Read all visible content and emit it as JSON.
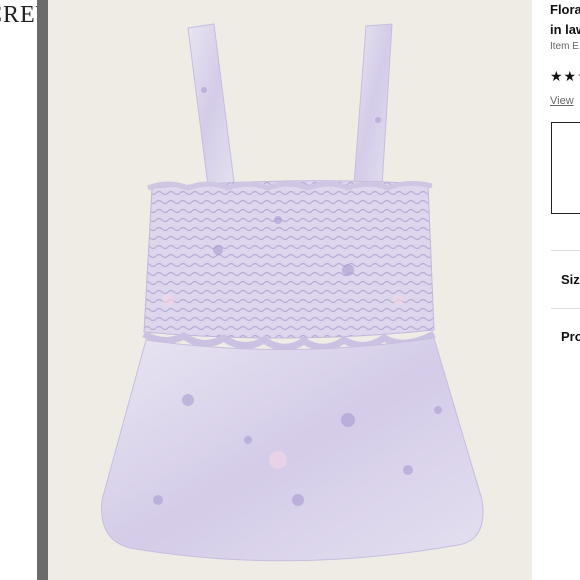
{
  "brand": {
    "logo_text": "CREW"
  },
  "product": {
    "title_line1": "Floral",
    "title_line2": "in law",
    "item_label": "Item E",
    "rating_stars": "★★☆",
    "view_link": "View"
  },
  "sections": {
    "size": "Siz",
    "product": "Pro"
  },
  "colors": {
    "image_bg": "#efece6",
    "garment": "#dcd6ea",
    "accent": "#9b8cc8"
  },
  "icons": {
    "wishlist": "heart-outline-icon"
  }
}
